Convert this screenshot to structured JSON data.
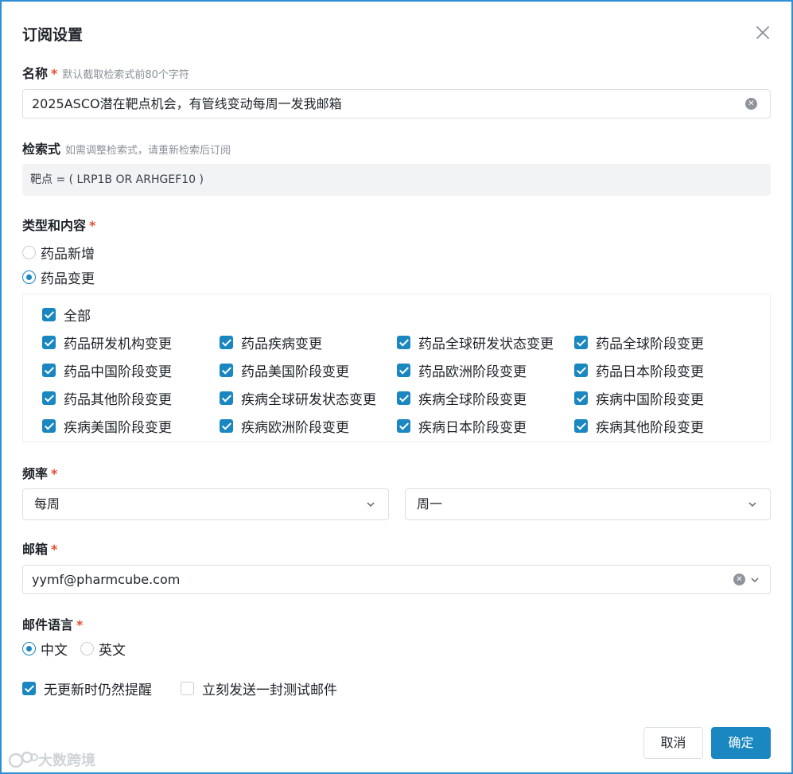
{
  "dialog": {
    "title": "订阅设置",
    "close_glyph": "✕"
  },
  "name": {
    "label": "名称",
    "required": "*",
    "hint": "默认截取检索式前80个字符",
    "value": "2025ASCO潜在靶点机会，有管线变动每周一发我邮箱"
  },
  "query": {
    "label": "检索式",
    "hint": "如需调整检索式，请重新检索后订阅",
    "value": "靶点 = ( LRP1B OR ARHGEF10 )"
  },
  "type": {
    "label": "类型和内容",
    "required": "*",
    "options": [
      {
        "label": "药品新增",
        "selected": false
      },
      {
        "label": "药品变更",
        "selected": true
      }
    ],
    "all_label": "全部",
    "all_checked": true,
    "items": [
      {
        "label": "药品研发机构变更",
        "checked": true
      },
      {
        "label": "药品疾病变更",
        "checked": true
      },
      {
        "label": "药品全球研发状态变更",
        "checked": true
      },
      {
        "label": "药品全球阶段变更",
        "checked": true
      },
      {
        "label": "药品中国阶段变更",
        "checked": true
      },
      {
        "label": "药品美国阶段变更",
        "checked": true
      },
      {
        "label": "药品欧洲阶段变更",
        "checked": true
      },
      {
        "label": "药品日本阶段变更",
        "checked": true
      },
      {
        "label": "药品其他阶段变更",
        "checked": true
      },
      {
        "label": "疾病全球研发状态变更",
        "checked": true
      },
      {
        "label": "疾病全球阶段变更",
        "checked": true
      },
      {
        "label": "疾病中国阶段变更",
        "checked": true
      },
      {
        "label": "疾病美国阶段变更",
        "checked": true
      },
      {
        "label": "疾病欧洲阶段变更",
        "checked": true
      },
      {
        "label": "疾病日本阶段变更",
        "checked": true
      },
      {
        "label": "疾病其他阶段变更",
        "checked": true
      }
    ]
  },
  "frequency": {
    "label": "频率",
    "required": "*",
    "period": "每周",
    "day": "周一"
  },
  "email": {
    "label": "邮箱",
    "required": "*",
    "value": "yymf@pharmcube.com"
  },
  "language": {
    "label": "邮件语言",
    "required": "*",
    "options": [
      {
        "label": "中文",
        "selected": true
      },
      {
        "label": "英文",
        "selected": false
      }
    ]
  },
  "options": {
    "remind_no_update": {
      "label": "无更新时仍然提醒",
      "checked": true
    },
    "send_test": {
      "label": "立刻发送一封测试邮件",
      "checked": false
    }
  },
  "footer": {
    "cancel": "取消",
    "confirm": "确定"
  },
  "watermark": {
    "text": "大数跨境"
  },
  "colors": {
    "primary": "#1a87c0",
    "required": "#e4502f",
    "border": "#dcdfe6"
  }
}
